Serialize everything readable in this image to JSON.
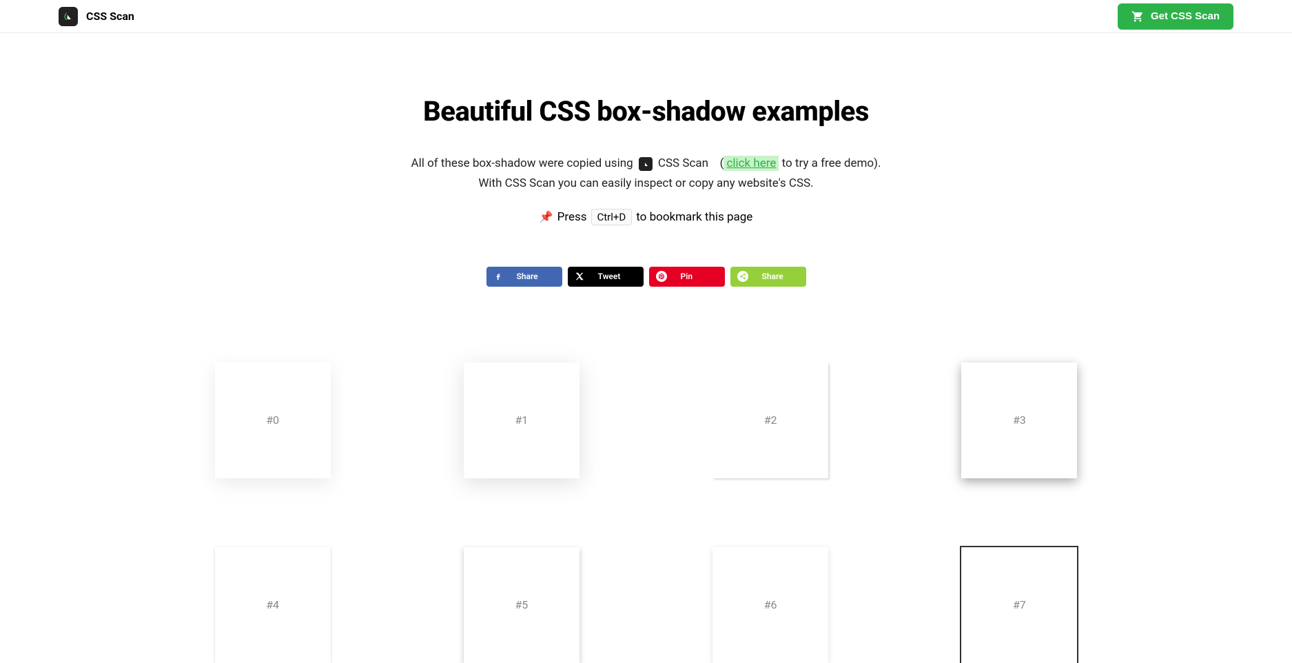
{
  "nav": {
    "brand_name": "CSS Scan",
    "cta_label": "Get CSS Scan"
  },
  "hero": {
    "title": "Beautiful CSS box-shadow examples",
    "sub_prefix": "All of these box-shadow were copied using",
    "sub_brand": "CSS Scan",
    "sub_paren_open": "(",
    "click_here": "click here",
    "sub_paren_close": " to try a free demo).",
    "sub_line2": "With CSS Scan you can easily inspect or copy any website's CSS.",
    "bookmark_emoji": "📌",
    "bookmark_press": "Press",
    "bookmark_kbd": "Ctrl+D",
    "bookmark_rest": "to bookmark this page"
  },
  "share": {
    "fb": "Share",
    "tw": "Tweet",
    "pin": "Pin",
    "st": "Share"
  },
  "cards": [
    {
      "label": "#0"
    },
    {
      "label": "#1"
    },
    {
      "label": "#2"
    },
    {
      "label": "#3"
    },
    {
      "label": "#4"
    },
    {
      "label": "#5"
    },
    {
      "label": "#6"
    },
    {
      "label": "#7"
    }
  ]
}
